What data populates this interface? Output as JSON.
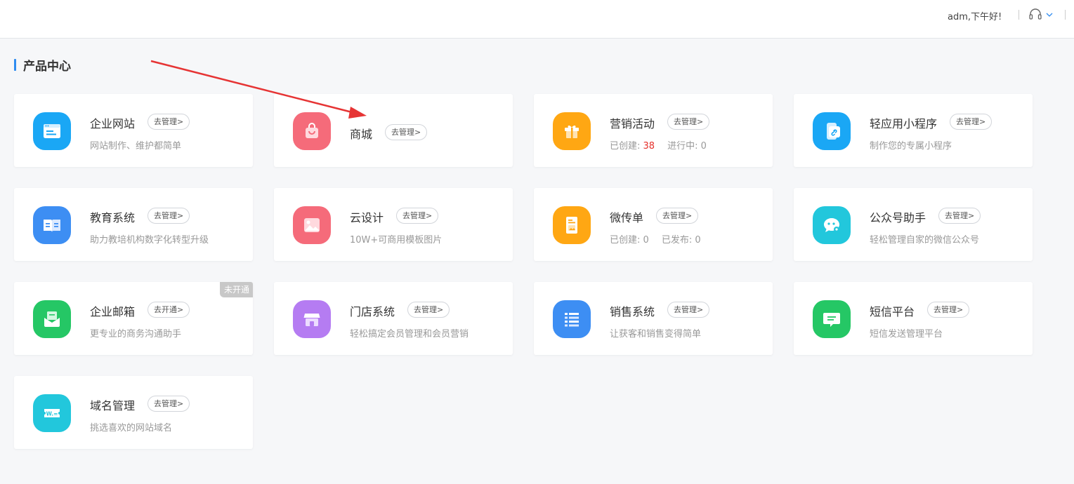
{
  "header": {
    "greeting": "adm,下午好!",
    "support_icon": "headset-icon",
    "menu_icon": "chevron-down-icon"
  },
  "section": {
    "title": "产品中心"
  },
  "colors": {
    "accent": "#2f8cf0",
    "stat_red": "#e5302a",
    "arrow": "#e63434"
  },
  "cards": [
    {
      "name": "企业网站",
      "action": "去管理>",
      "desc": "网站制作、维护都简单",
      "icon": "website-icon",
      "color": "#1aa7f5"
    },
    {
      "name": "商城",
      "action": "去管理>",
      "desc": "",
      "icon": "shopping-bag-icon",
      "color": "#f56b7a"
    },
    {
      "name": "营销活动",
      "action": "去管理>",
      "icon": "gift-icon",
      "color": "#ffa713",
      "stats": {
        "created_label": "已创建:",
        "created_value": "38",
        "running_label": "进行中:",
        "running_value": "0"
      }
    },
    {
      "name": "轻应用小程序",
      "action": "去管理>",
      "desc": "制作您的专属小程序",
      "icon": "mini-program-icon",
      "color": "#1aa7f5"
    },
    {
      "name": "教育系统",
      "action": "去管理>",
      "desc": "助力教培机构数字化转型升级",
      "icon": "book-icon",
      "color": "#3d8ef3"
    },
    {
      "name": "云设计",
      "action": "去管理>",
      "desc": "10W+可商用模板图片",
      "icon": "image-icon",
      "color": "#f56b7a"
    },
    {
      "name": "微传单",
      "action": "去管理>",
      "icon": "flyer-icon",
      "color": "#ffa713",
      "stats": {
        "created_label": "已创建:",
        "created_value": "0",
        "published_label": "已发布:",
        "published_value": "0"
      }
    },
    {
      "name": "公众号助手",
      "action": "去管理>",
      "desc": "轻松管理自家的微信公众号",
      "icon": "wechat-bubble-icon",
      "color": "#22c7dc"
    },
    {
      "name": "企业邮箱",
      "action": "去开通>",
      "desc": "更专业的商务沟通助手",
      "icon": "mail-icon",
      "color": "#25c765",
      "badge": "未开通"
    },
    {
      "name": "门店系统",
      "action": "去管理>",
      "desc": "轻松搞定会员管理和会员营销",
      "icon": "store-icon",
      "color": "#b57cf2"
    },
    {
      "name": "销售系统",
      "action": "去管理>",
      "desc": "让获客和销售变得简单",
      "icon": "list-icon",
      "color": "#3d8ef3"
    },
    {
      "name": "短信平台",
      "action": "去管理>",
      "desc": "短信发送管理平台",
      "icon": "sms-icon",
      "color": "#25c765"
    },
    {
      "name": "域名管理",
      "action": "去管理>",
      "desc": "挑选喜欢的网站域名",
      "icon": "domain-icon",
      "color": "#22c7dc",
      "icon_text": "W.="
    }
  ]
}
